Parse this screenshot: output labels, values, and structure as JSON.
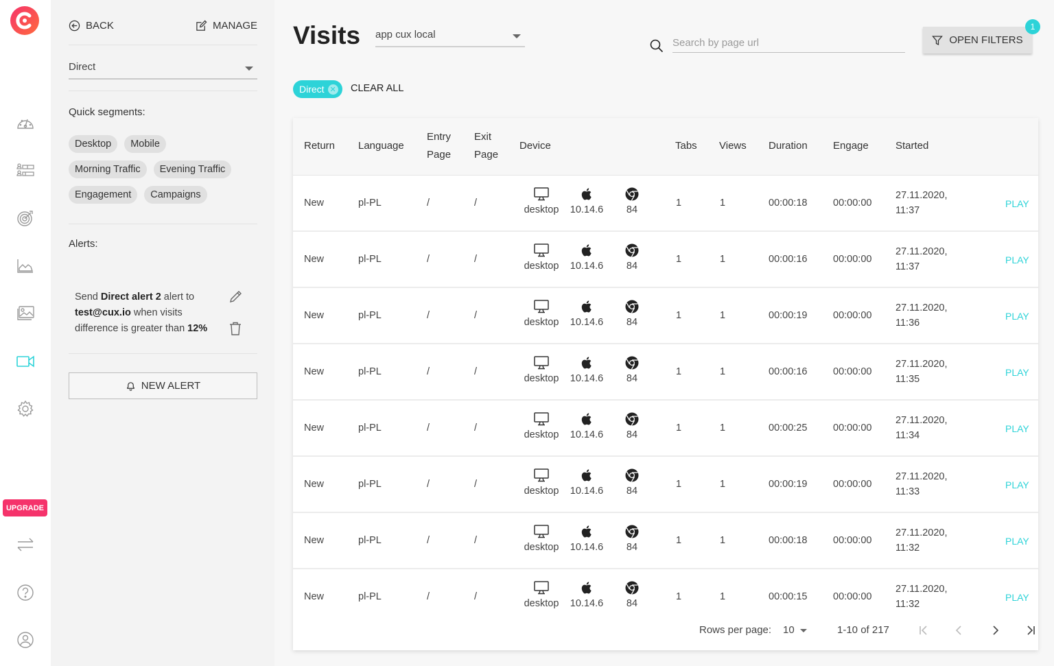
{
  "rail": {
    "upgrade_label": "UPGRADE",
    "items": [
      {
        "name": "dashboard",
        "icon": "speedometer-icon",
        "active": false
      },
      {
        "name": "users",
        "icon": "users-list-icon",
        "active": false
      },
      {
        "name": "goals",
        "icon": "target-icon",
        "active": false
      },
      {
        "name": "analytics",
        "icon": "area-chart-icon",
        "active": false
      },
      {
        "name": "heatmaps",
        "icon": "images-icon",
        "active": false
      },
      {
        "name": "recordings",
        "icon": "video-camera-icon",
        "active": true
      },
      {
        "name": "settings",
        "icon": "gear-icon",
        "active": false
      },
      {
        "name": "switch",
        "icon": "swap-arrows-icon",
        "active": false
      },
      {
        "name": "help",
        "icon": "help-circle-icon",
        "active": false
      },
      {
        "name": "account",
        "icon": "user-circle-icon",
        "active": false
      }
    ]
  },
  "panel": {
    "back_label": "BACK",
    "manage_label": "MANAGE",
    "segment_value": "Direct",
    "quick_segments_label": "Quick segments:",
    "quick_segments": [
      [
        "Desktop",
        "Mobile"
      ],
      [
        "Morning Traffic",
        "Evening Traffic"
      ],
      [
        "Engagement",
        "Campaigns"
      ]
    ],
    "alerts_label": "Alerts:",
    "alert": {
      "t1": "Send ",
      "name": "Direct alert 2",
      "t2": " alert to ",
      "email": "test@cux.io",
      "t3": " when visits difference is greater than ",
      "threshold": "12%"
    },
    "new_alert_label": "NEW ALERT"
  },
  "main": {
    "title": "Visits",
    "app_select_value": "app cux local",
    "search_placeholder": "Search by page url",
    "search_value": "",
    "open_filters_label": "OPEN FILTERS",
    "filters_count": "1",
    "active_filter": "Direct",
    "clear_all_label": "CLEAR ALL"
  },
  "colors": {
    "accent": "#2dd3d8",
    "upgrade": "#f5336b",
    "logo": "#f5336b"
  },
  "table": {
    "headers": {
      "return": "Return",
      "language": "Language",
      "entry_1": "Entry",
      "entry_2": "Page",
      "exit_1": "Exit",
      "exit_2": "Page",
      "device": "Device",
      "tabs": "Tabs",
      "views": "Views",
      "duration": "Duration",
      "engage": "Engage",
      "started": "Started"
    },
    "play_label": "PLAY",
    "rows": [
      {
        "return": "New",
        "language": "pl-PL",
        "entry": "/",
        "exit": "/",
        "device": "desktop",
        "os": "10.14.6",
        "browser": "84",
        "tabs": "1",
        "views": "1",
        "duration": "00:00:18",
        "engage": "00:00:00",
        "date": "27.11.2020,",
        "time": "11:37"
      },
      {
        "return": "New",
        "language": "pl-PL",
        "entry": "/",
        "exit": "/",
        "device": "desktop",
        "os": "10.14.6",
        "browser": "84",
        "tabs": "1",
        "views": "1",
        "duration": "00:00:16",
        "engage": "00:00:00",
        "date": "27.11.2020,",
        "time": "11:37"
      },
      {
        "return": "New",
        "language": "pl-PL",
        "entry": "/",
        "exit": "/",
        "device": "desktop",
        "os": "10.14.6",
        "browser": "84",
        "tabs": "1",
        "views": "1",
        "duration": "00:00:19",
        "engage": "00:00:00",
        "date": "27.11.2020,",
        "time": "11:36"
      },
      {
        "return": "New",
        "language": "pl-PL",
        "entry": "/",
        "exit": "/",
        "device": "desktop",
        "os": "10.14.6",
        "browser": "84",
        "tabs": "1",
        "views": "1",
        "duration": "00:00:16",
        "engage": "00:00:00",
        "date": "27.11.2020,",
        "time": "11:35"
      },
      {
        "return": "New",
        "language": "pl-PL",
        "entry": "/",
        "exit": "/",
        "device": "desktop",
        "os": "10.14.6",
        "browser": "84",
        "tabs": "1",
        "views": "1",
        "duration": "00:00:25",
        "engage": "00:00:00",
        "date": "27.11.2020,",
        "time": "11:34"
      },
      {
        "return": "New",
        "language": "pl-PL",
        "entry": "/",
        "exit": "/",
        "device": "desktop",
        "os": "10.14.6",
        "browser": "84",
        "tabs": "1",
        "views": "1",
        "duration": "00:00:19",
        "engage": "00:00:00",
        "date": "27.11.2020,",
        "time": "11:33"
      },
      {
        "return": "New",
        "language": "pl-PL",
        "entry": "/",
        "exit": "/",
        "device": "desktop",
        "os": "10.14.6",
        "browser": "84",
        "tabs": "1",
        "views": "1",
        "duration": "00:00:18",
        "engage": "00:00:00",
        "date": "27.11.2020,",
        "time": "11:32"
      },
      {
        "return": "New",
        "language": "pl-PL",
        "entry": "/",
        "exit": "/",
        "device": "desktop",
        "os": "10.14.6",
        "browser": "84",
        "tabs": "1",
        "views": "1",
        "duration": "00:00:15",
        "engage": "00:00:00",
        "date": "27.11.2020,",
        "time": "11:32"
      }
    ],
    "footer": {
      "rows_per_page_label": "Rows per page:",
      "rows_per_page_value": "10",
      "range_text": "1-10 of 217"
    }
  }
}
